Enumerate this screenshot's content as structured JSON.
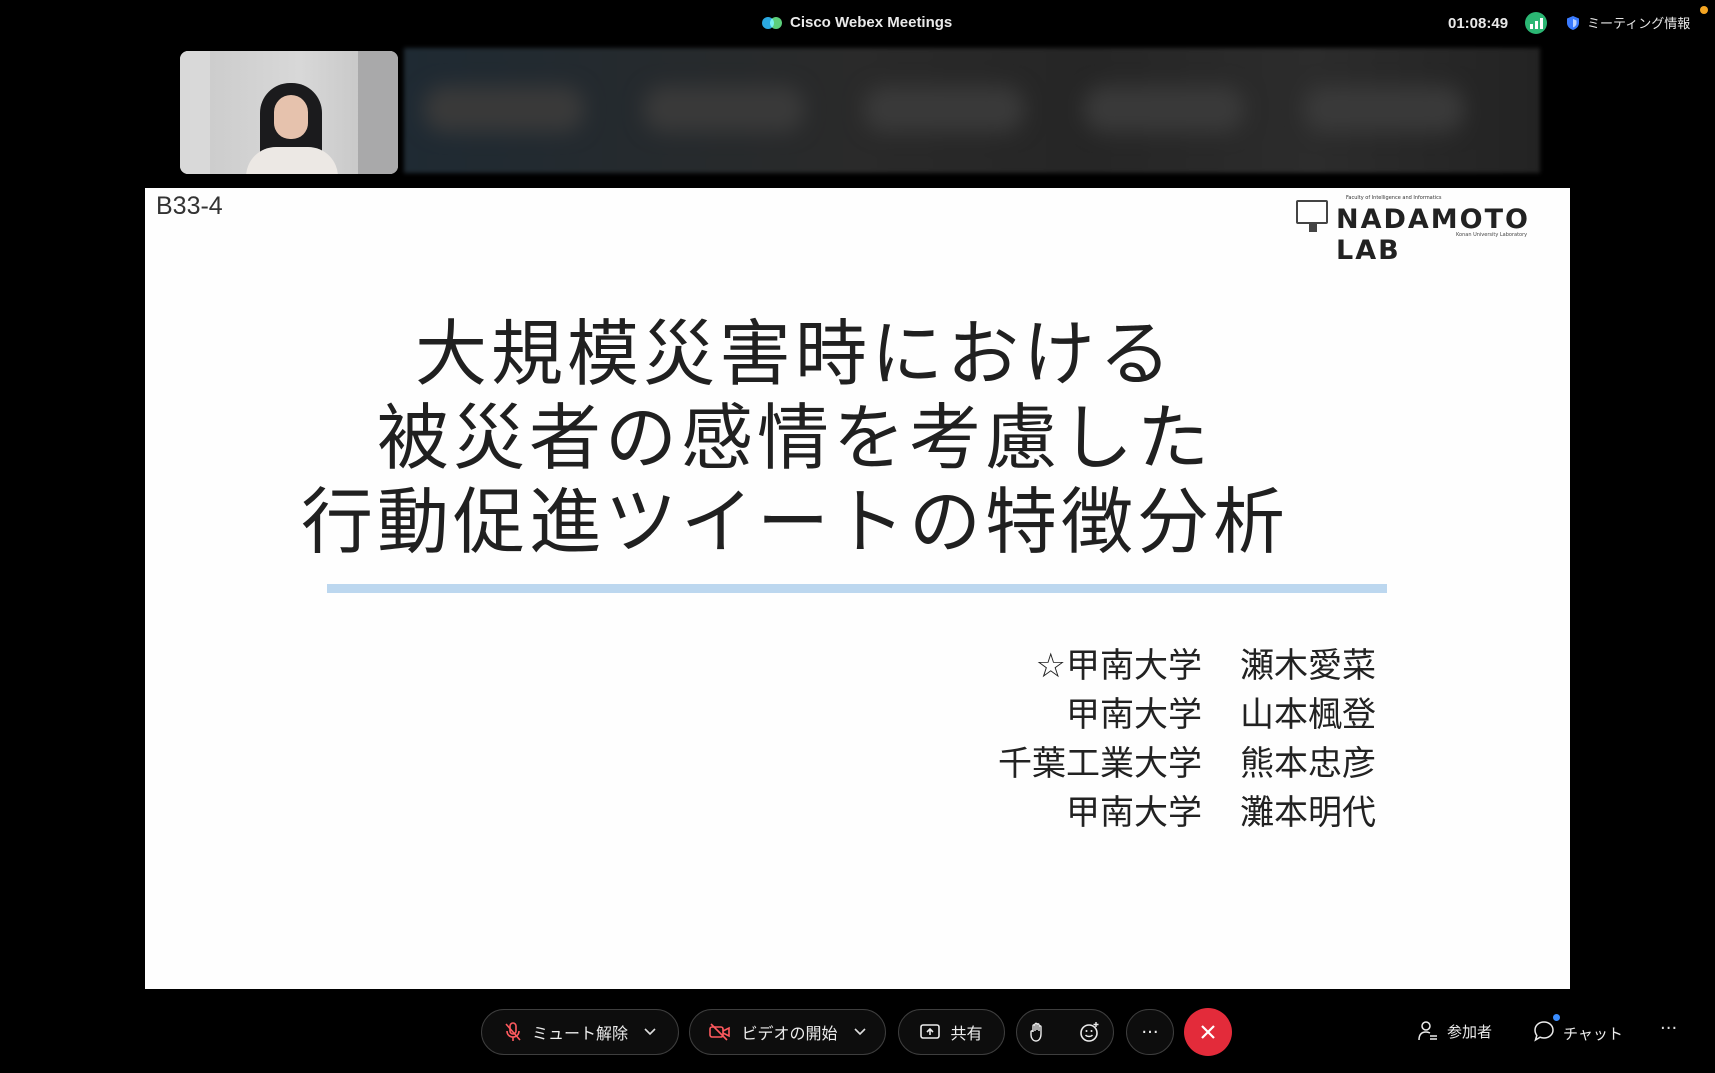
{
  "window": {
    "app_title": "Cisco Webex Meetings",
    "elapsed_time": "01:08:49",
    "meeting_info_label": "ミーティング情報"
  },
  "slide": {
    "id": "B33-4",
    "lab_logo": {
      "faculty": "Faculty of Intelligence and Informatics",
      "name": "NADAMOTO LAB",
      "subtitle": "Konan University Laboratory"
    },
    "title_lines": [
      "大規模災害時における",
      "被災者の感情を考慮した",
      "行動促進ツイートの特徴分析"
    ],
    "authors": [
      {
        "affiliation": "☆甲南大学",
        "name": "瀬木愛菜"
      },
      {
        "affiliation": "甲南大学",
        "name": "山本楓登"
      },
      {
        "affiliation": "千葉工業大学",
        "name": "熊本忠彦"
      },
      {
        "affiliation": "甲南大学",
        "name": "灘本明代"
      }
    ]
  },
  "controls": {
    "unmute_label": "ミュート解除",
    "start_video_label": "ビデオの開始",
    "share_label": "共有",
    "more_label": "···",
    "participants_label": "参加者",
    "chat_label": "チャット",
    "overflow_label": "···"
  },
  "colors": {
    "background": "#000000",
    "leave_button": "#e32b3a",
    "signal_indicator": "#2bb673",
    "underline_accent": "#bcd7ef",
    "chat_badge": "#3a8dff",
    "notification_dot": "#f5a623"
  },
  "icons": {
    "mute": "microphone-off-icon",
    "video": "camera-off-icon",
    "share": "share-screen-icon",
    "raise_hand": "raise-hand-icon",
    "reactions": "emoji-icon",
    "leave": "close-icon",
    "participants": "participants-icon",
    "chat": "chat-bubble-icon",
    "signal": "signal-strength-icon",
    "meeting_info": "shield-icon"
  }
}
